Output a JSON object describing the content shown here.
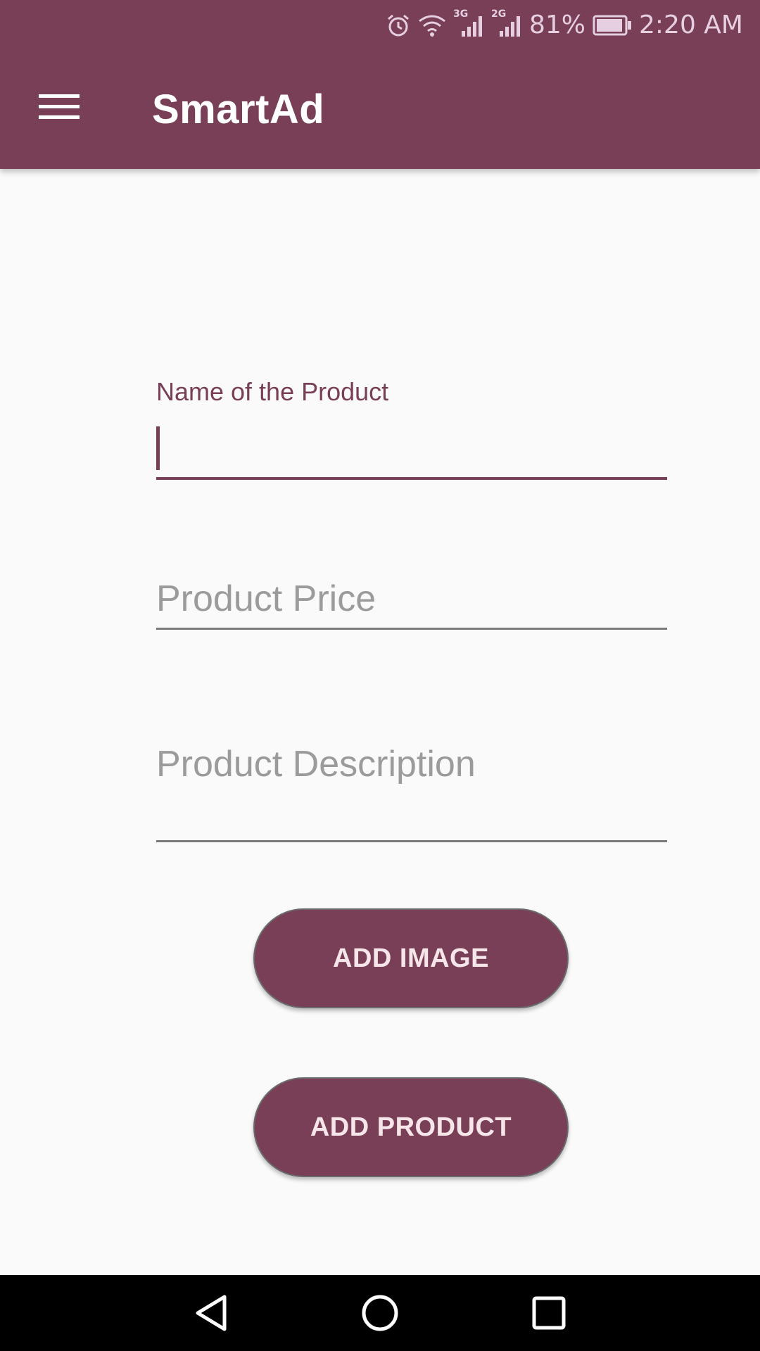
{
  "status_bar": {
    "battery_percent": "81%",
    "time": "2:20 AM",
    "network_1": "3G",
    "network_2": "2G",
    "icons": [
      "alarm-icon",
      "wifi-icon",
      "signal-3g-icon",
      "signal-2g-icon",
      "battery-icon"
    ]
  },
  "toolbar": {
    "title": "SmartAd",
    "menu_icon": "hamburger-menu-icon"
  },
  "form": {
    "name_label": "Name of the Product",
    "name_value": "",
    "price_placeholder": "Product Price",
    "price_value": "",
    "description_placeholder": "Product Description",
    "description_value": ""
  },
  "buttons": {
    "add_image": "ADD IMAGE",
    "add_product": "ADD PRODUCT"
  },
  "nav_bar": {
    "icons": [
      "back-icon",
      "home-icon",
      "recents-icon"
    ]
  },
  "colors": {
    "primary": "#783f57",
    "background": "#fafafa",
    "button_text": "#f6e6ea",
    "placeholder": "#9b9b9b"
  }
}
